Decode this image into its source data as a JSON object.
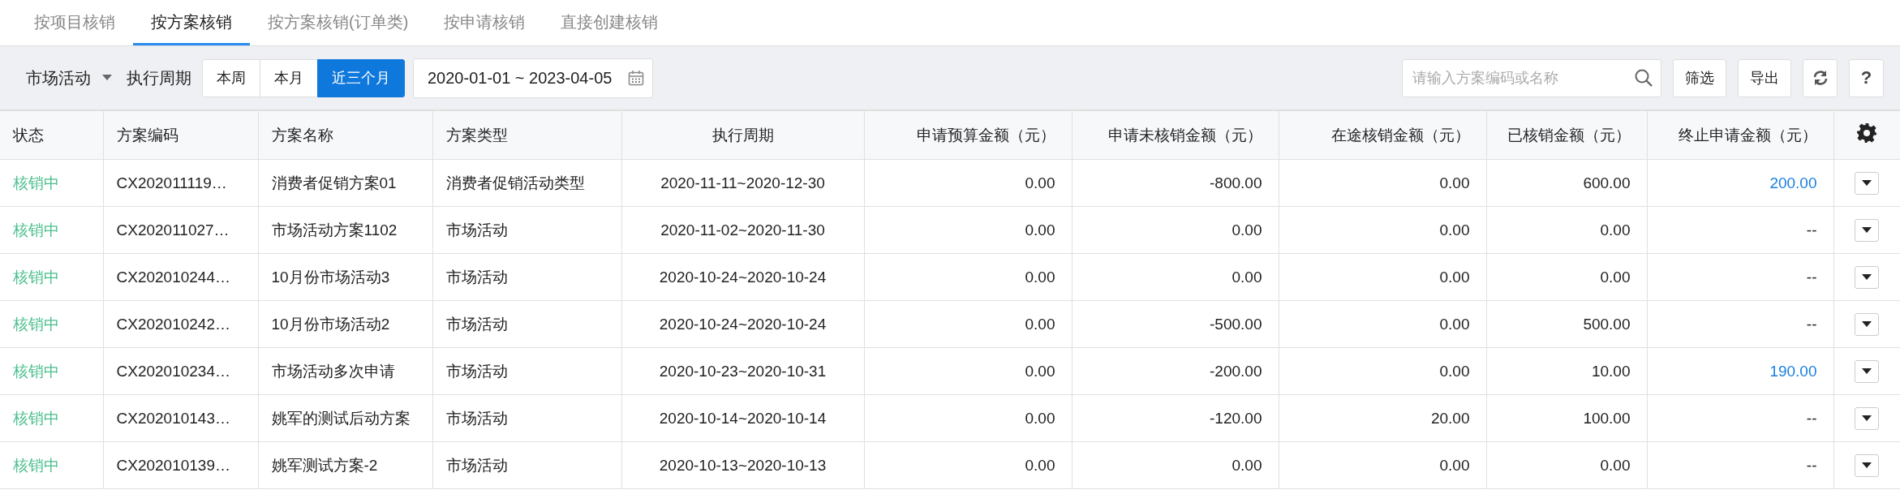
{
  "tabs": [
    {
      "label": "按项目核销",
      "selected": false
    },
    {
      "label": "按方案核销",
      "selected": true
    },
    {
      "label": "按方案核销(订单类)",
      "selected": false
    },
    {
      "label": "按申请核销",
      "selected": false
    },
    {
      "label": "直接创建核销",
      "selected": false
    }
  ],
  "toolbar": {
    "category": "市场活动",
    "period_label": "执行周期",
    "periods": [
      {
        "label": "本周",
        "selected": false
      },
      {
        "label": "本月",
        "selected": false
      },
      {
        "label": "近三个月",
        "selected": true
      }
    ],
    "date_range": "2020-01-01 ~ 2023-04-05",
    "search": {
      "placeholder": "请输入方案编码或名称"
    },
    "buttons": [
      "筛选",
      "导出"
    ],
    "help": "?"
  },
  "table": {
    "columns": [
      "状态",
      "方案编码",
      "方案名称",
      "方案类型",
      "执行周期",
      "申请预算金额（元）",
      "申请未核销金额（元）",
      "在途核销金额（元）",
      "已核销金额（元）",
      "终止申请金额（元）"
    ],
    "rows": [
      {
        "status": "核销中",
        "code": "CX202011119…",
        "name": "消费者促销方案01",
        "type": "消费者促销活动类型",
        "period": "2020-11-11~2020-12-30",
        "budget": "0.00",
        "unverified": "-800.00",
        "in_transit": "0.00",
        "verified": "600.00",
        "terminated": {
          "text": "200.00",
          "link": true
        }
      },
      {
        "status": "核销中",
        "code": "CX202011027…",
        "name": "市场活动方案1102",
        "type": "市场活动",
        "period": "2020-11-02~2020-11-30",
        "budget": "0.00",
        "unverified": "0.00",
        "in_transit": "0.00",
        "verified": "0.00",
        "terminated": {
          "text": "--",
          "link": false
        }
      },
      {
        "status": "核销中",
        "code": "CX202010244…",
        "name": "10月份市场活动3",
        "type": "市场活动",
        "period": "2020-10-24~2020-10-24",
        "budget": "0.00",
        "unverified": "0.00",
        "in_transit": "0.00",
        "verified": "0.00",
        "terminated": {
          "text": "--",
          "link": false
        }
      },
      {
        "status": "核销中",
        "code": "CX202010242…",
        "name": "10月份市场活动2",
        "type": "市场活动",
        "period": "2020-10-24~2020-10-24",
        "budget": "0.00",
        "unverified": "-500.00",
        "in_transit": "0.00",
        "verified": "500.00",
        "terminated": {
          "text": "--",
          "link": false
        }
      },
      {
        "status": "核销中",
        "code": "CX202010234…",
        "name": "市场活动多次申请",
        "type": "市场活动",
        "period": "2020-10-23~2020-10-31",
        "budget": "0.00",
        "unverified": "-200.00",
        "in_transit": "0.00",
        "verified": "10.00",
        "terminated": {
          "text": "190.00",
          "link": true
        }
      },
      {
        "status": "核销中",
        "code": "CX202010143…",
        "name": "姚军的测试后动方案",
        "type": "市场活动",
        "period": "2020-10-14~2020-10-14",
        "budget": "0.00",
        "unverified": "-120.00",
        "in_transit": "20.00",
        "verified": "100.00",
        "terminated": {
          "text": "--",
          "link": false
        }
      },
      {
        "status": "核销中",
        "code": "CX202010139…",
        "name": "姚军测试方案-2",
        "type": "市场活动",
        "period": "2020-10-13~2020-10-13",
        "budget": "0.00",
        "unverified": "0.00",
        "in_transit": "0.00",
        "verified": "0.00",
        "terminated": {
          "text": "--",
          "link": false
        }
      }
    ]
  }
}
